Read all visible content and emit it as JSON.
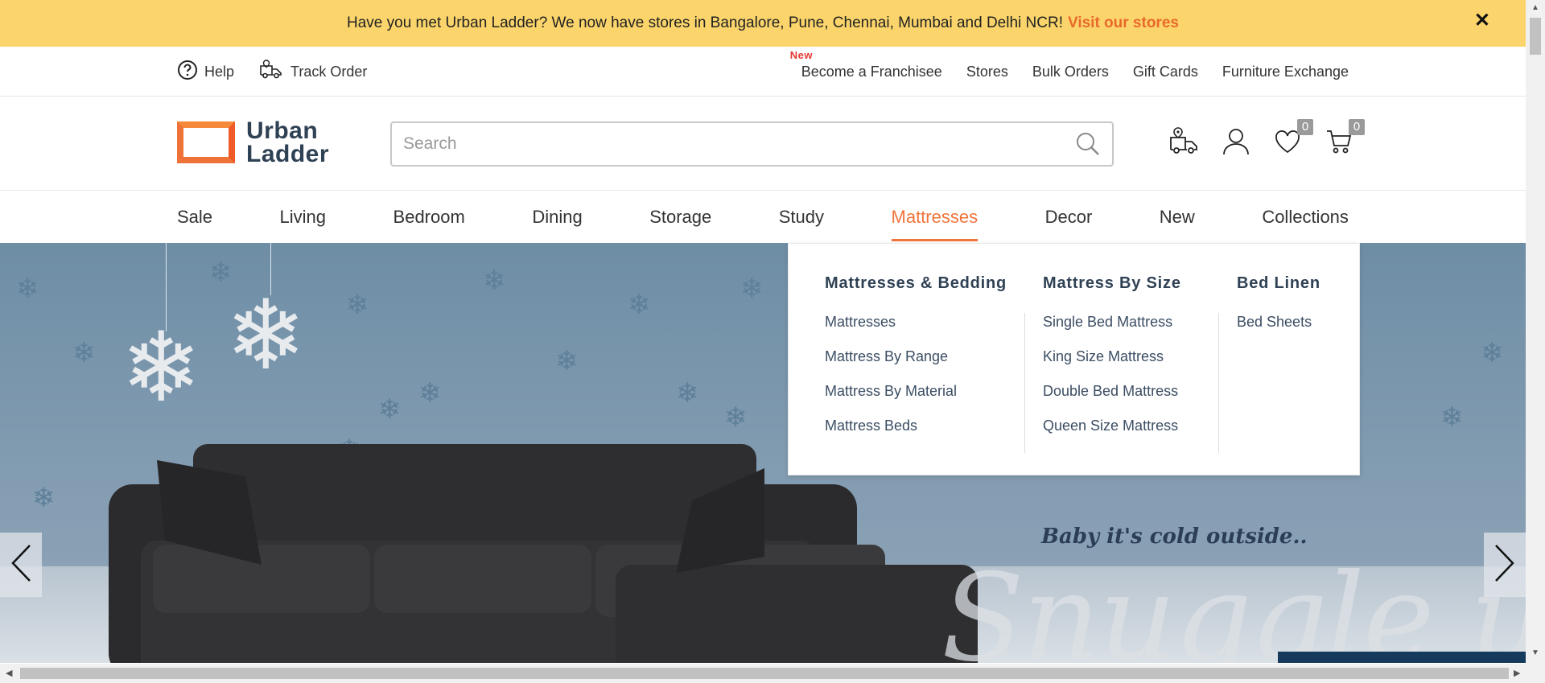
{
  "announcement": {
    "text": "Have you met Urban Ladder? We now have stores in Bangalore, Pune, Chennai, Mumbai and Delhi NCR!",
    "link": "Visit our stores",
    "close": "✕"
  },
  "utility": {
    "help": "Help",
    "track_order": "Track Order",
    "new_badge": "New",
    "links": [
      "Become a Franchisee",
      "Stores",
      "Bulk Orders",
      "Gift Cards",
      "Furniture Exchange"
    ]
  },
  "header": {
    "logo_line1": "Urban",
    "logo_line2": "Ladder",
    "search_placeholder": "Search",
    "wishlist_count": "0",
    "cart_count": "0"
  },
  "nav": {
    "items": [
      "Sale",
      "Living",
      "Bedroom",
      "Dining",
      "Storage",
      "Study",
      "Mattresses",
      "Decor",
      "New",
      "Collections"
    ],
    "active": "Mattresses"
  },
  "mega_menu": {
    "columns": [
      {
        "title": "Mattresses & Bedding",
        "items": [
          "Mattresses",
          "Mattress By Range",
          "Mattress By Material",
          "Mattress Beds"
        ]
      },
      {
        "title": "Mattress By Size",
        "items": [
          "Single Bed Mattress",
          "King Size Mattress",
          "Double Bed Mattress",
          "Queen Size Mattress"
        ]
      },
      {
        "title": "Bed Linen",
        "items": [
          "Bed Sheets"
        ]
      }
    ]
  },
  "hero": {
    "tagline": "Baby it's cold outside..",
    "script_text": "Snuggle up"
  },
  "colors": {
    "accent": "#f0743a",
    "announce_bg": "#fbd56b",
    "brand_navy": "#2f4154"
  }
}
